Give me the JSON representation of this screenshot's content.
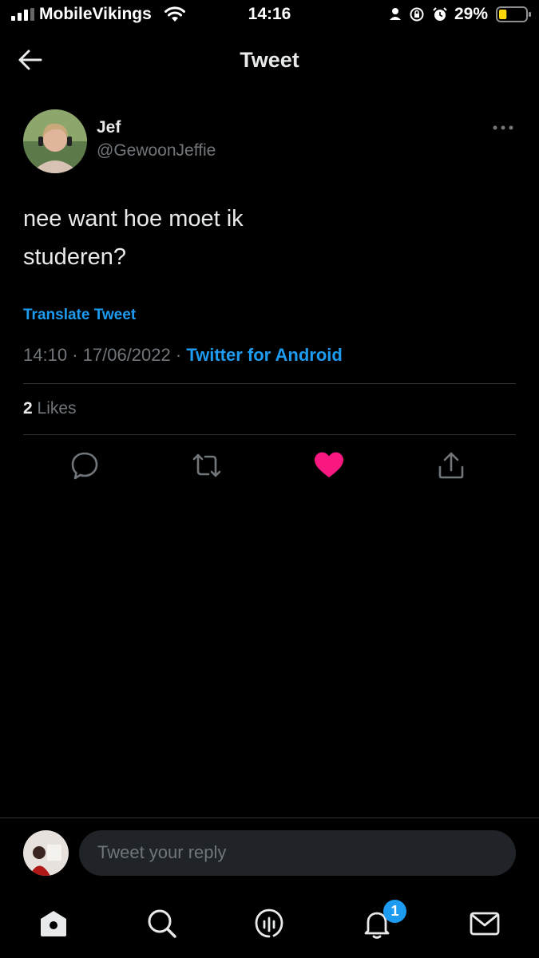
{
  "status_bar": {
    "carrier": "MobileVikings",
    "time": "14:16",
    "battery_percent": "29%",
    "battery_level": 0.29,
    "icons": [
      "signal-icon",
      "wifi-icon",
      "person-icon",
      "rotation-lock-icon",
      "alarm-icon",
      "battery-icon"
    ]
  },
  "header": {
    "title": "Tweet",
    "back_icon": "arrow-left-icon"
  },
  "tweet": {
    "name": "Jef",
    "handle": "@GewoonJeffie",
    "text_line1": "nee want hoe moet ik",
    "text_line2": "studeren?",
    "translate_label": "Translate Tweet",
    "time": "14:10",
    "date": "17/06/2022",
    "separator": "·",
    "source": "Twitter for Android",
    "likes_count": "2",
    "likes_label": "Likes",
    "liked": true
  },
  "actions": [
    "reply-icon",
    "retweet-icon",
    "like-icon",
    "share-icon"
  ],
  "reply": {
    "placeholder": "Tweet your reply"
  },
  "bottom_nav": {
    "items": [
      "home-icon",
      "search-icon",
      "spaces-icon",
      "notifications-icon",
      "messages-icon"
    ],
    "notifications_badge": "1"
  },
  "colors": {
    "background": "#000000",
    "accent": "#1d9bf0",
    "like": "#f91880",
    "muted": "#71767b"
  }
}
